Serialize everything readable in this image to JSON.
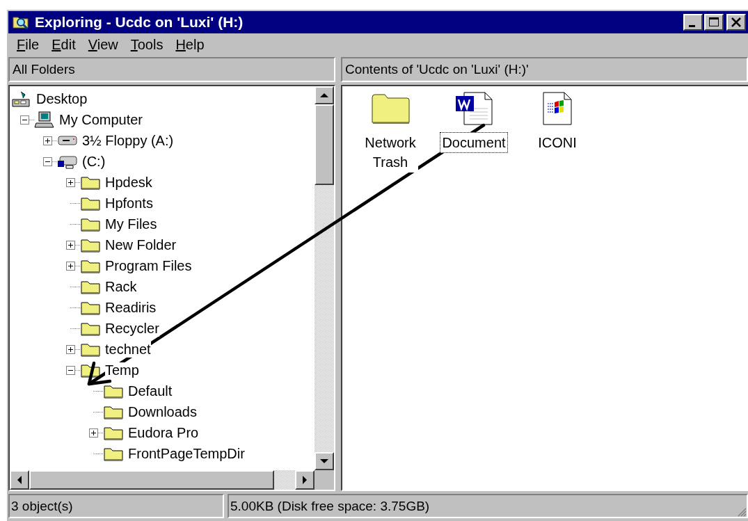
{
  "window": {
    "title": "Exploring - Ucdc on 'Luxi' (H:)"
  },
  "menu": [
    "File",
    "Edit",
    "View",
    "Tools",
    "Help"
  ],
  "left_header": "All Folders",
  "right_header": "Contents of 'Ucdc on 'Luxi' (H:)'",
  "tree": [
    {
      "label": "Desktop",
      "kind": "desktop",
      "children": [
        {
          "label": "My Computer",
          "kind": "computer",
          "expanded": true,
          "children": [
            {
              "label": "3½ Floppy (A:)",
              "kind": "floppy",
              "expanded": false
            },
            {
              "label": "(C:)",
              "kind": "drive",
              "expanded": true,
              "children": [
                {
                  "label": "Hpdesk",
                  "kind": "folder",
                  "expanded": false
                },
                {
                  "label": "Hpfonts",
                  "kind": "folder"
                },
                {
                  "label": "My Files",
                  "kind": "folder"
                },
                {
                  "label": "New Folder",
                  "kind": "folder",
                  "expanded": false
                },
                {
                  "label": "Program Files",
                  "kind": "folder",
                  "expanded": false
                },
                {
                  "label": "Rack",
                  "kind": "folder"
                },
                {
                  "label": "Readiris",
                  "kind": "folder"
                },
                {
                  "label": "Recycler",
                  "kind": "folder"
                },
                {
                  "label": "technet",
                  "kind": "folder",
                  "expanded": false
                },
                {
                  "label": "Temp",
                  "kind": "folder",
                  "expanded": true,
                  "children": [
                    {
                      "label": "Default",
                      "kind": "folder"
                    },
                    {
                      "label": "Downloads",
                      "kind": "folder"
                    },
                    {
                      "label": "Eudora Pro",
                      "kind": "folder",
                      "expanded": false
                    },
                    {
                      "label": "FrontPageTempDir",
                      "kind": "folder"
                    }
                  ]
                }
              ]
            }
          ]
        }
      ]
    }
  ],
  "files": [
    {
      "name": "Network Trash",
      "kind": "folder",
      "selected": false
    },
    {
      "name": "Document",
      "kind": "word",
      "selected": true
    },
    {
      "name": "ICONI",
      "kind": "app",
      "selected": false
    }
  ],
  "status_bar": [
    "3 object(s)",
    "5.00KB (Disk free space: 3.75GB)"
  ]
}
